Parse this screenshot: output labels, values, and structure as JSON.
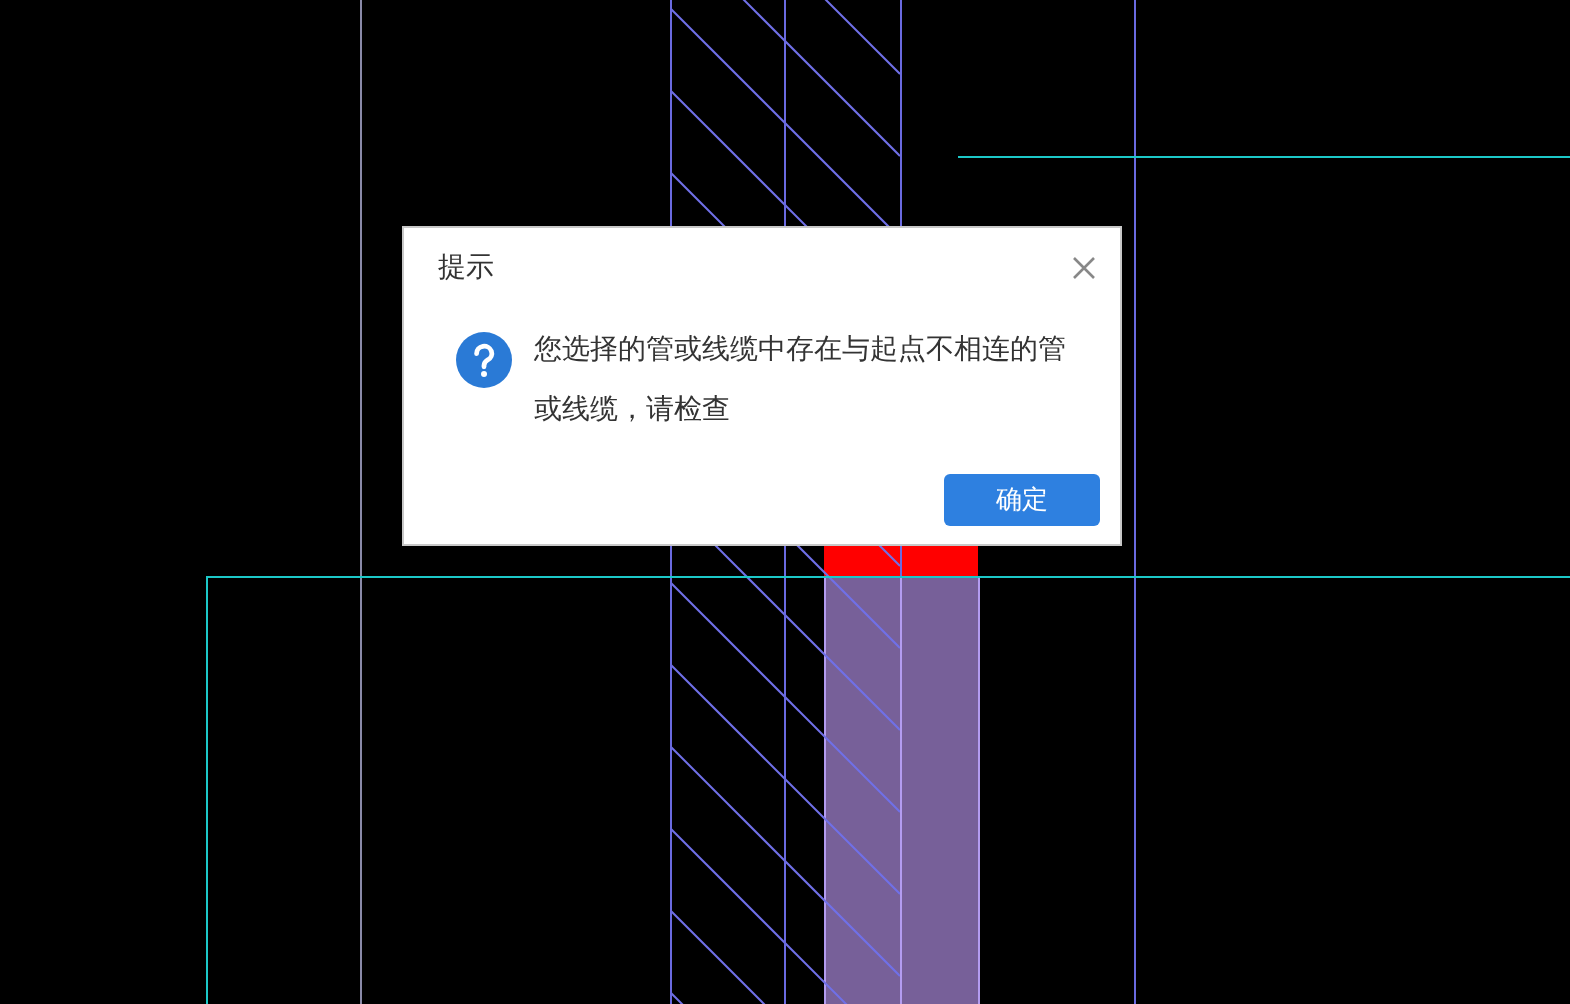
{
  "dialog": {
    "title": "提示",
    "message": "您选择的管或线缆中存在与起点不相连的管或线缆，请检查",
    "buttons": [
      {
        "label": "确定",
        "kind": "primary"
      }
    ]
  }
}
